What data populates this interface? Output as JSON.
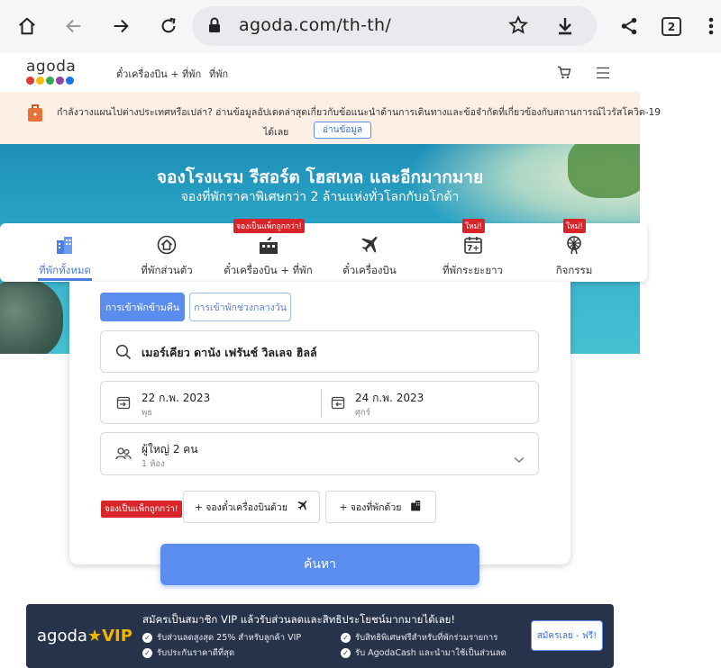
{
  "browser": {
    "url": "agoda.com/th-th/",
    "tab_count": "2"
  },
  "nav": {
    "logo": "agoda",
    "links": [
      "ตั๋วเครื่องบิน + ที่พัก",
      "ที่พัก"
    ]
  },
  "notice": {
    "text": "กำลังวางแผนไปต่างประเทศหรือเปล่า? อ่านข้อมูลอัปเดตล่าสุดเกี่ยวกับข้อแนะนำด้านการเดินทางและข้อจำกัดที่เกี่ยวข้องกับสถานการณ์ไวรัสโควิด-19",
    "text2": "ได้เลย",
    "button": "อ่านข้อมูล"
  },
  "hero": {
    "title": "จองโรงแรม รีสอร์ต โฮสเทล และอีกมากมาย",
    "subtitle": "จองที่พักราคาพิเศษกว่า 2 ล้านแห่งทั่วโลกกับอโกด้า"
  },
  "categories": [
    {
      "label": "ที่พักทั้งหมด",
      "icon": "building-icon",
      "badge": ""
    },
    {
      "label": "ที่พักส่วนตัว",
      "icon": "home-icon",
      "badge": ""
    },
    {
      "label": "ตั๋วเครื่องบิน + ที่พัก",
      "icon": "flight-hotel-icon",
      "badge": "จองเป็นแพ็กถูกกว่า!"
    },
    {
      "label": "ตั๋วเครื่องบิน",
      "icon": "plane-icon",
      "badge": ""
    },
    {
      "label": "ที่พักระยะยาว",
      "icon": "calendar-7-icon",
      "badge": "ใหม่!"
    },
    {
      "label": "กิจกรรม",
      "icon": "ferris-wheel-icon",
      "badge": "ใหม่!"
    }
  ],
  "search": {
    "toggle_overnight": "การเข้าพักข้ามคืน",
    "toggle_day": "การเข้าพักช่วงกลางวัน",
    "destination": "เมอร์เคียว ดานัง เฟรันช์ วิลเลจ ฮิลล์",
    "checkin_date": "22 ก.พ. 2023",
    "checkin_day": "พุธ",
    "checkout_date": "24 ก.พ. 2023",
    "checkout_day": "ศุกร์",
    "guests": "ผู้ใหญ่ 2 คน",
    "rooms": "1 ห้อง",
    "package_badge": "จองเป็นแพ็กถูกกว่า!",
    "add_flight": "+ จองตั๋วเครื่องบินด้วย",
    "add_hotel": "+ จองที่พักด้วย",
    "submit": "ค้นหา"
  },
  "vip": {
    "logo_main": "agoda",
    "logo_vip": "VIP",
    "title": "สมัครเป็นสมาชิก VIP แล้วรับส่วนลดและสิทธิประโยชน์มากมายได้เลย!",
    "benefits": [
      "รับส่วนลดสูงสุด 25% สำหรับลูกค้า VIP",
      "รับสิทธิพิเศษฟรีสำหรับที่พักร่วมรายการ",
      "รับประกันราคาดีที่สุด",
      "รับ AgodaCash และนำมาใช้เป็นส่วนลด"
    ],
    "button": "สมัครเลย - ฟรี!"
  },
  "colors": {
    "accent": "#5b8def",
    "badge_red": "#d9252a",
    "vip_bg": "#27334a",
    "notice_bg": "#fcefe5"
  }
}
